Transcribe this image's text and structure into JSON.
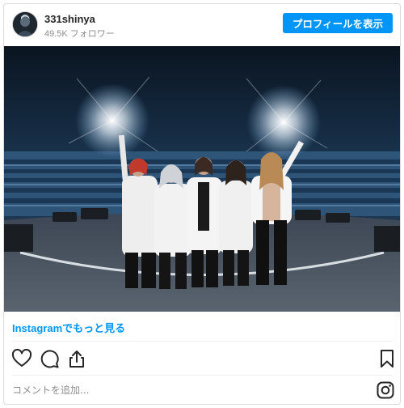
{
  "header": {
    "username": "331shinya",
    "followers": "49.5K フォロワー",
    "profile_button": "プロフィールを表示"
  },
  "post": {
    "image_alt": "Band of five posing on stage in front of a large concert crowd under stage lights",
    "view_more_link": "Instagramでもっと見る"
  },
  "actions": {
    "like": "heart-icon",
    "comment": "comment-icon",
    "share": "share-icon",
    "save": "bookmark-icon"
  },
  "comment": {
    "placeholder": "コメントを追加..."
  },
  "colors": {
    "accent": "#0095f6",
    "text": "#262626",
    "muted": "#8e8e8e"
  }
}
